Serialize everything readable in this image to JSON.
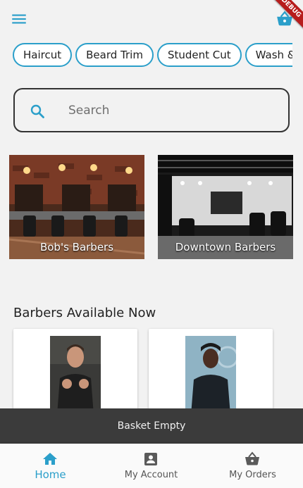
{
  "header": {
    "menu_icon": "menu-icon",
    "cart_icon": "shopping-basket-icon",
    "debug_banner": "DEBUG"
  },
  "categories": [
    "Haircut",
    "Beard Trim",
    "Student Cut",
    "Wash &"
  ],
  "search": {
    "placeholder": "Search",
    "icon": "search-icon"
  },
  "shops": [
    {
      "name": "Bob's Barbers"
    },
    {
      "name": "Downtown Barbers"
    }
  ],
  "section": {
    "title": "Barbers Available Now"
  },
  "basket": {
    "status": "Basket Empty"
  },
  "bottom_nav": {
    "items": [
      {
        "label": "Home",
        "icon": "home-icon",
        "active": true
      },
      {
        "label": "My Account",
        "icon": "account-box-icon",
        "active": false
      },
      {
        "label": "My Orders",
        "icon": "shopping-basket-icon",
        "active": false
      }
    ]
  },
  "colors": {
    "accent": "#2b9fca",
    "basket_bar": "#3b3b3b",
    "background": "#f2f2f2"
  }
}
